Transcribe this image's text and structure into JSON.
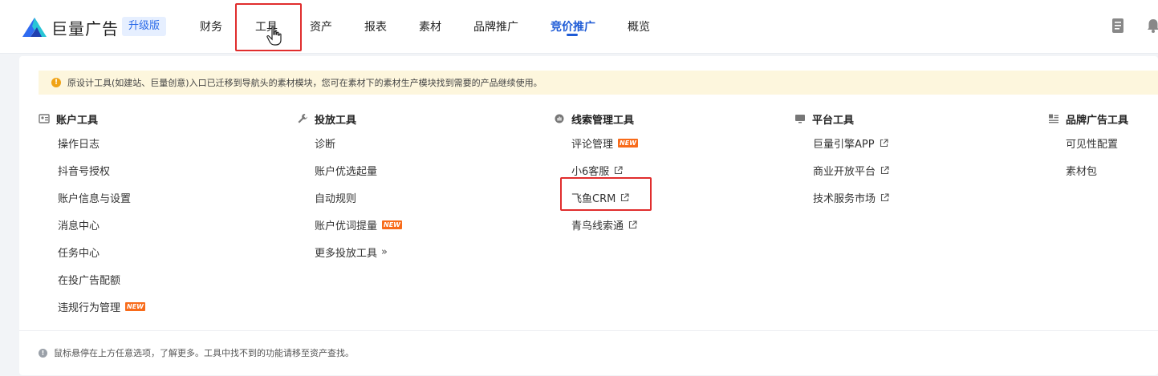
{
  "header": {
    "brand": "巨量广告",
    "edition_badge": "升级版",
    "nav": [
      {
        "label": "财务"
      },
      {
        "label": "工具"
      },
      {
        "label": "资产"
      },
      {
        "label": "报表"
      },
      {
        "label": "素材"
      },
      {
        "label": "品牌推广"
      },
      {
        "label": "竞价推广"
      },
      {
        "label": "概览"
      }
    ],
    "active_nav": "竞价推广",
    "hovered_nav": "工具"
  },
  "notice": {
    "icon": "warning-icon",
    "text": "原设计工具(如建站、巨量创意)入口已迁移到导航头的素材模块，您可在素材下的素材生产模块找到需要的产品继续使用。"
  },
  "columns": [
    {
      "title": "账户工具",
      "icon": "account-tools-icon",
      "items": [
        {
          "label": "操作日志"
        },
        {
          "label": "抖音号授权"
        },
        {
          "label": "账户信息与设置"
        },
        {
          "label": "消息中心"
        },
        {
          "label": "任务中心"
        },
        {
          "label": "在投广告配额"
        },
        {
          "label": "违规行为管理",
          "badge": "NEW"
        }
      ]
    },
    {
      "title": "投放工具",
      "icon": "wrench-icon",
      "items": [
        {
          "label": "诊断"
        },
        {
          "label": "账户优选起量"
        },
        {
          "label": "自动规则"
        },
        {
          "label": "账户优词提量",
          "badge": "NEW"
        },
        {
          "label": "更多投放工具",
          "suffix": "»"
        }
      ]
    },
    {
      "title": "线索管理工具",
      "icon": "leads-icon",
      "items": [
        {
          "label": "评论管理",
          "badge": "NEW"
        },
        {
          "label": "小6客服",
          "external": true
        },
        {
          "label": "飞鱼CRM",
          "external": true
        },
        {
          "label": "青鸟线索通",
          "external": true
        }
      ]
    },
    {
      "title": "平台工具",
      "icon": "monitor-icon",
      "items": [
        {
          "label": "巨量引擎APP",
          "external": true
        },
        {
          "label": "商业开放平台",
          "external": true
        },
        {
          "label": "技术服务市场",
          "external": true
        }
      ]
    },
    {
      "title": "品牌广告工具",
      "icon": "brand-tools-icon",
      "items": [
        {
          "label": "可见性配置"
        },
        {
          "label": "素材包"
        }
      ]
    }
  ],
  "footer": {
    "icon": "info-icon",
    "text": "鼠标悬停在上方任意选项，了解更多。工具中找不到的功能请移至资产查找。"
  },
  "colors": {
    "brand_blue": "#1e5bd6",
    "annotation_red": "#e02d2d",
    "new_tag": "#f86b1a",
    "notice_bg": "#fdf6dd"
  }
}
